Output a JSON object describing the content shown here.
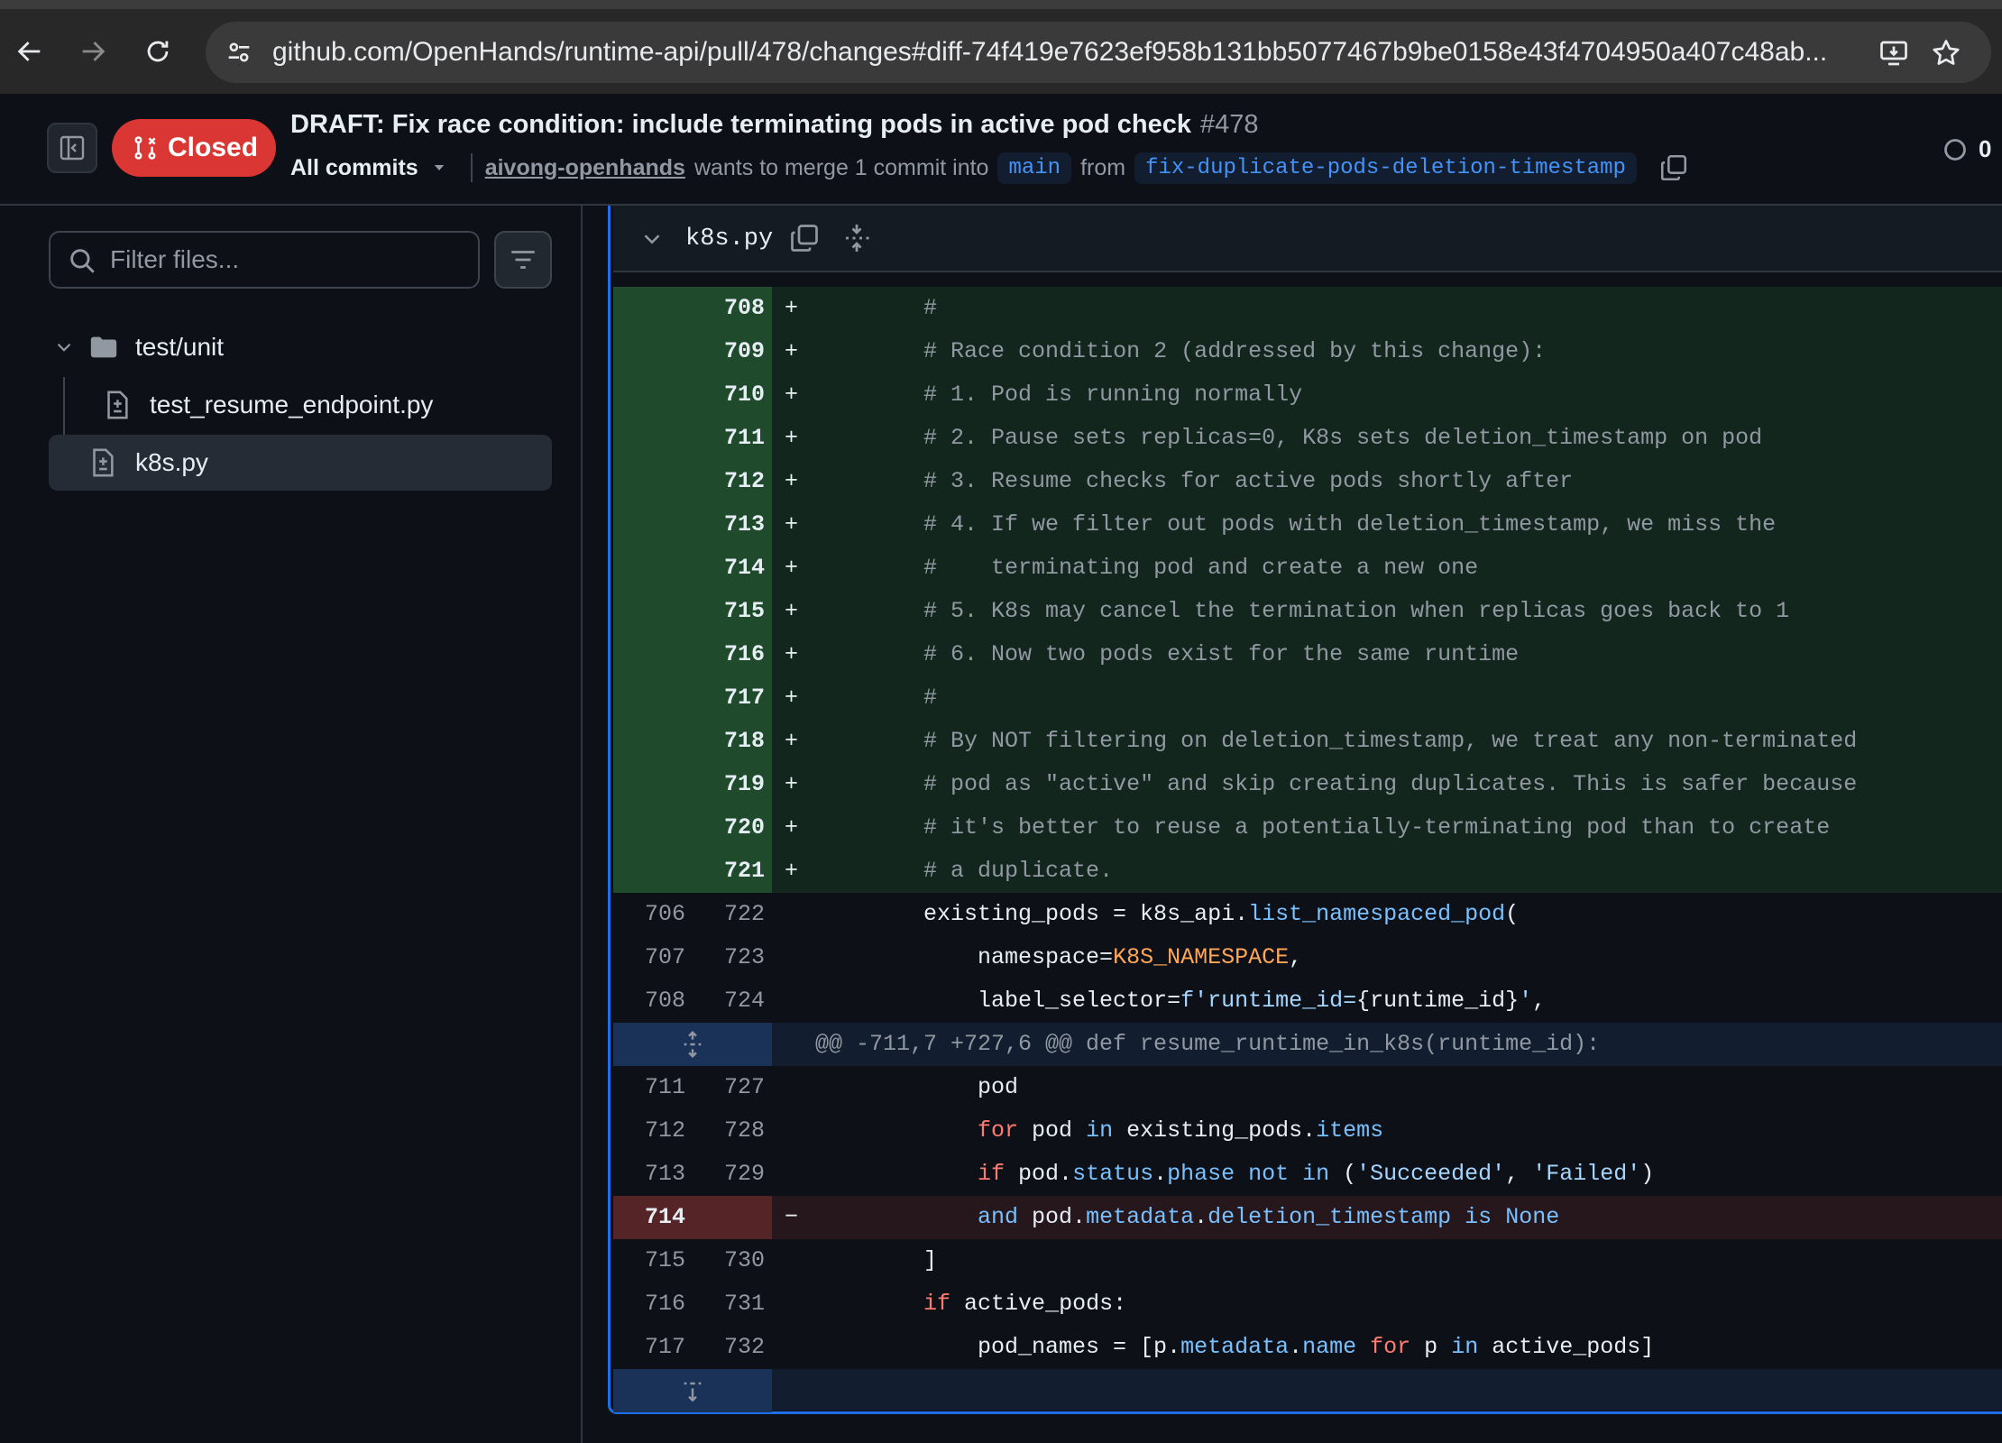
{
  "browser": {
    "url": "github.com/OpenHands/runtime-api/pull/478/changes#diff-74f419e7623ef958b131bb5077467b9be0158e43f4704950a407c48ab..."
  },
  "pr": {
    "state": "Closed",
    "title": "DRAFT: Fix race condition: include terminating pods in active pod check",
    "number": "#478",
    "commits_selector": "All commits",
    "author": "aivong-openhands",
    "merge_text": "wants to merge 1 commit into",
    "base_branch": "main",
    "from_text": "from",
    "head_branch": "fix-duplicate-pods-deletion-timestamp",
    "right_count": "0"
  },
  "sidebar": {
    "filter_placeholder": "Filter files...",
    "tree": [
      {
        "type": "folder",
        "label": "test/unit"
      },
      {
        "type": "file",
        "label": "test_resume_endpoint.py"
      },
      {
        "type": "file",
        "label": "k8s.py",
        "active": true
      }
    ]
  },
  "diff": {
    "file_name": "k8s.py",
    "lines": [
      {
        "kind": "add",
        "old": "",
        "new": "708",
        "marker": "+",
        "tokens": [
          [
            "        ",
            ""
          ],
          [
            "#",
            "cmt"
          ]
        ]
      },
      {
        "kind": "add",
        "old": "",
        "new": "709",
        "marker": "+",
        "tokens": [
          [
            "        ",
            ""
          ],
          [
            "# Race condition 2 (addressed by this change):",
            "cmt"
          ]
        ]
      },
      {
        "kind": "add",
        "old": "",
        "new": "710",
        "marker": "+",
        "tokens": [
          [
            "        ",
            ""
          ],
          [
            "# 1. Pod is running normally",
            "cmt"
          ]
        ]
      },
      {
        "kind": "add",
        "old": "",
        "new": "711",
        "marker": "+",
        "tokens": [
          [
            "        ",
            ""
          ],
          [
            "# 2. Pause sets replicas=0, K8s sets deletion_timestamp on pod",
            "cmt"
          ]
        ]
      },
      {
        "kind": "add",
        "old": "",
        "new": "712",
        "marker": "+",
        "tokens": [
          [
            "        ",
            ""
          ],
          [
            "# 3. Resume checks for active pods shortly after",
            "cmt"
          ]
        ]
      },
      {
        "kind": "add",
        "old": "",
        "new": "713",
        "marker": "+",
        "tokens": [
          [
            "        ",
            ""
          ],
          [
            "# 4. If we filter out pods with deletion_timestamp, we miss the",
            "cmt"
          ]
        ]
      },
      {
        "kind": "add",
        "old": "",
        "new": "714",
        "marker": "+",
        "tokens": [
          [
            "        ",
            ""
          ],
          [
            "#    terminating pod and create a new one",
            "cmt"
          ]
        ]
      },
      {
        "kind": "add",
        "old": "",
        "new": "715",
        "marker": "+",
        "tokens": [
          [
            "        ",
            ""
          ],
          [
            "# 5. K8s may cancel the termination when replicas goes back to 1",
            "cmt"
          ]
        ]
      },
      {
        "kind": "add",
        "old": "",
        "new": "716",
        "marker": "+",
        "tokens": [
          [
            "        ",
            ""
          ],
          [
            "# 6. Now two pods exist for the same runtime",
            "cmt"
          ]
        ]
      },
      {
        "kind": "add",
        "old": "",
        "new": "717",
        "marker": "+",
        "tokens": [
          [
            "        ",
            ""
          ],
          [
            "#",
            "cmt"
          ]
        ]
      },
      {
        "kind": "add",
        "old": "",
        "new": "718",
        "marker": "+",
        "tokens": [
          [
            "        ",
            ""
          ],
          [
            "# By NOT filtering on deletion_timestamp, we treat any non-terminated",
            "cmt"
          ]
        ]
      },
      {
        "kind": "add",
        "old": "",
        "new": "719",
        "marker": "+",
        "tokens": [
          [
            "        ",
            ""
          ],
          [
            "# pod as \"active\" and skip creating duplicates. This is safer because",
            "cmt"
          ]
        ]
      },
      {
        "kind": "add",
        "old": "",
        "new": "720",
        "marker": "+",
        "tokens": [
          [
            "        ",
            ""
          ],
          [
            "# it's better to reuse a potentially-terminating pod than to create",
            "cmt"
          ]
        ]
      },
      {
        "kind": "add",
        "old": "",
        "new": "721",
        "marker": "+",
        "tokens": [
          [
            "        ",
            ""
          ],
          [
            "# a duplicate.",
            "cmt"
          ]
        ]
      },
      {
        "kind": "ctx",
        "old": "706",
        "new": "722",
        "marker": "",
        "tokens": [
          [
            "        existing_pods = k8s_api.",
            ""
          ],
          [
            "list_namespaced_pod",
            "fn"
          ],
          [
            "(",
            ""
          ]
        ]
      },
      {
        "kind": "ctx",
        "old": "707",
        "new": "723",
        "marker": "",
        "tokens": [
          [
            "            namespace=",
            ""
          ],
          [
            "K8S_NAMESPACE",
            "const"
          ],
          [
            ",",
            ""
          ]
        ]
      },
      {
        "kind": "ctx",
        "old": "708",
        "new": "724",
        "marker": "",
        "tokens": [
          [
            "            label_selector=",
            ""
          ],
          [
            "f'runtime_id=",
            "str"
          ],
          [
            "{runtime_id}",
            ""
          ],
          [
            "'",
            "str"
          ],
          [
            ",",
            ""
          ]
        ]
      },
      {
        "kind": "hunk",
        "old": "",
        "new": "",
        "marker": "",
        "tokens": [
          [
            "@@ -711,7 +727,6 @@ def resume_runtime_in_k8s(runtime_id):",
            ""
          ]
        ]
      },
      {
        "kind": "ctx",
        "old": "711",
        "new": "727",
        "marker": "",
        "tokens": [
          [
            "            pod",
            ""
          ]
        ]
      },
      {
        "kind": "ctx",
        "old": "712",
        "new": "728",
        "marker": "",
        "tokens": [
          [
            "            ",
            ""
          ],
          [
            "for",
            "kw"
          ],
          [
            " pod ",
            ""
          ],
          [
            "in",
            "fn"
          ],
          [
            " existing_pods.",
            ""
          ],
          [
            "items",
            "attr"
          ]
        ]
      },
      {
        "kind": "ctx",
        "old": "713",
        "new": "729",
        "marker": "",
        "tokens": [
          [
            "            ",
            ""
          ],
          [
            "if",
            "kw"
          ],
          [
            " pod.",
            ""
          ],
          [
            "status",
            "attr"
          ],
          [
            ".",
            ""
          ],
          [
            "phase",
            "attr"
          ],
          [
            " ",
            ""
          ],
          [
            "not in",
            "fn"
          ],
          [
            " (",
            ""
          ],
          [
            "'Succeeded'",
            "str"
          ],
          [
            ", ",
            ""
          ],
          [
            "'Failed'",
            "str"
          ],
          [
            ")",
            ""
          ]
        ]
      },
      {
        "kind": "del",
        "old": "714",
        "new": "",
        "marker": "−",
        "tokens": [
          [
            "            ",
            ""
          ],
          [
            "and",
            "fn"
          ],
          [
            " pod.",
            ""
          ],
          [
            "metadata",
            "attr"
          ],
          [
            ".",
            ""
          ],
          [
            "deletion_timestamp",
            "attr"
          ],
          [
            " ",
            ""
          ],
          [
            "is",
            "fn"
          ],
          [
            " ",
            ""
          ],
          [
            "None",
            "fn"
          ]
        ]
      },
      {
        "kind": "ctx",
        "old": "715",
        "new": "730",
        "marker": "",
        "tokens": [
          [
            "        ]",
            ""
          ]
        ]
      },
      {
        "kind": "ctx",
        "old": "716",
        "new": "731",
        "marker": "",
        "tokens": [
          [
            "        ",
            ""
          ],
          [
            "if",
            "kw"
          ],
          [
            " active_pods:",
            ""
          ]
        ]
      },
      {
        "kind": "ctx",
        "old": "717",
        "new": "732",
        "marker": "",
        "tokens": [
          [
            "            pod_names = [p.",
            ""
          ],
          [
            "metadata",
            "attr"
          ],
          [
            ".",
            ""
          ],
          [
            "name",
            "attr"
          ],
          [
            " ",
            ""
          ],
          [
            "for",
            "kw"
          ],
          [
            " p ",
            ""
          ],
          [
            "in",
            "fn"
          ],
          [
            " active_pods]",
            ""
          ]
        ]
      },
      {
        "kind": "expand",
        "old": "",
        "new": "",
        "marker": "",
        "tokens": []
      }
    ]
  }
}
